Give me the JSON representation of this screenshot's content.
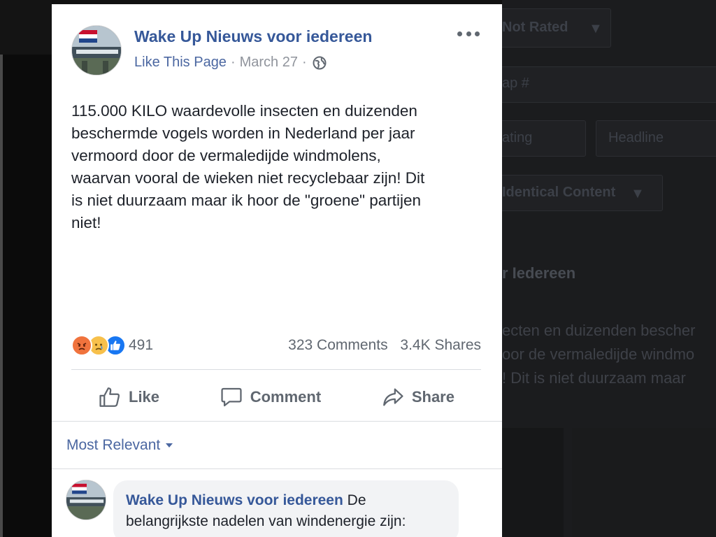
{
  "background": {
    "not_rated": "Not Rated",
    "field_placeholder": "ap #",
    "rating_label": "ating",
    "headline_label": "Headline",
    "identical_content": "Identical Content",
    "title_fragment": "r Iedereen",
    "text_lines": [
      "ecten en duizenden bescher",
      "oor de vermaledijde windmo",
      "! Dit is niet duurzaam maar"
    ]
  },
  "post": {
    "page_name": "Wake Up Nieuws voor iedereen",
    "like_page": "Like This Page",
    "date": "March 27",
    "body": "115.000 KILO waardevolle insecten en duizenden\nbeschermde vogels worden in Nederland per jaar\nvermoord door de vermaledijde windmolens,\nwaarvan vooral de wieken niet recyclebaar zijn! Dit\nis niet duurzaam maar ik hoor de \"groene\" partijen\nniet!",
    "reaction_count": "491",
    "comments": "323 Comments",
    "shares": "3.4K Shares",
    "actions": {
      "like": "Like",
      "comment": "Comment",
      "share": "Share"
    },
    "sort": "Most Relevant",
    "first_comment": {
      "author": "Wake Up Nieuws voor iedereen",
      "text": " De belangrijkste nadelen van windenergie zijn:"
    }
  },
  "colors": {
    "link_blue": "#365899",
    "text_dark": "#1d2129",
    "text_gray": "#606770",
    "like_blue": "#1877f2",
    "angry_orange": "#f0733d",
    "sad_yellow": "#f7c04b"
  },
  "icons": [
    "globe-icon",
    "more-icon",
    "angry-reaction-icon",
    "sad-reaction-icon",
    "like-reaction-icon",
    "like-icon",
    "comment-icon",
    "share-icon"
  ]
}
